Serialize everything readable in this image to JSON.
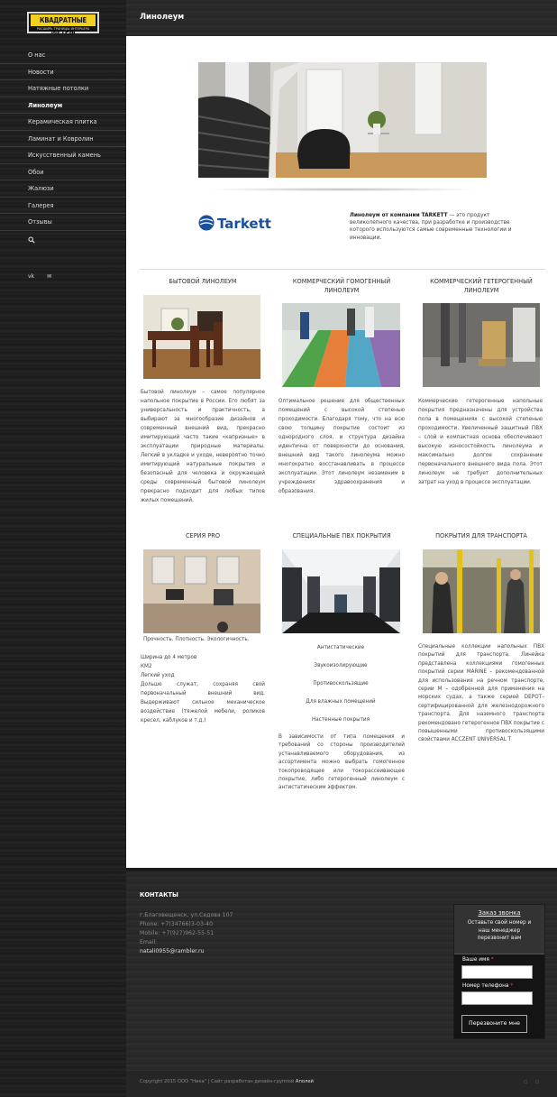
{
  "logo": {
    "line1": "КВАДРАТНЫЕ МЕТРЫ",
    "line2": "РАСШИРЬ ГРАНИЦЫ ИНТЕРЬЕРА"
  },
  "menu": [
    {
      "label": "О нас"
    },
    {
      "label": "Новости"
    },
    {
      "label": "Натяжные потолки"
    },
    {
      "label": "Линолеум",
      "active": true
    },
    {
      "label": "Керамическая плитка"
    },
    {
      "label": "Ламинат и Ковролин"
    },
    {
      "label": "Искусственный камень"
    },
    {
      "label": "Обои"
    },
    {
      "label": "Жалюзи"
    },
    {
      "label": "Галерея"
    },
    {
      "label": "Отзывы"
    }
  ],
  "social": {
    "vk": "vk",
    "mail": "✉"
  },
  "page_title": "Линолеум",
  "brand": "Tarkett",
  "intro": {
    "bold": "Линолеум от компании TARKETT",
    "rest": " — это продукт великолепного качества, при разработке и производстве которого используются самые современные технологии и инновации."
  },
  "columns": [
    {
      "title": "БЫТОВОЙ ЛИНОЛЕУМ",
      "text": "Бытовой линолеум – самое популярное напольное покрытие в России. Его любят за универсальность и практичность, а выбирают за многообразие дизайнов и современный внешний вид, прекрасно имитирующий часто такие «капризные» в эксплуатации природные материалы. Легкий в укладке и уходе, невероятно точно имитирующий натуральные покрытия и безопасный для человека и окружающей среды современный бытовой линолеум прекрасно подходит для любых типов жилых помещений."
    },
    {
      "title": "КОММЕРЧЕСКИЙ ГОМОГЕННЫЙ ЛИНОЛЕУМ",
      "text": "Оптимальное решение для общественных помещений с высокой степенью проходимости. Благодаря тому, что на всю свою толщину покрытие состоит из однородного слоя, и структура дизайна идентична от поверхности до основания, внешний вид такого линолеума можно многократно восстанавливать в процессе эксплуатации. Этот линолеум незаменим в учреждениях здравоохранения и образования."
    },
    {
      "title": "КОММЕРЧЕСКИЙ ГЕТЕРОГЕННЫЙ ЛИНОЛЕУМ",
      "text": "Коммерческие гетерогенные напольные покрытия предназначены для устройства пола в помещениях с высокой степенью проходимости. Увеличенный защитный ПВХ – слой и компактная основа обеспечивают высокую износостойкость линолеума и максимально долгое сохранение первоначального внешнего вида пола. Этот линолеум не требует дополнительных затрат на уход в процессе эксплуатации."
    }
  ],
  "series_pro": {
    "title": "СЕРИЯ PRO",
    "tagline": "Прочность. Плотность. Экологичность.",
    "lines": [
      "Ширина до 4 метров",
      "КМ2",
      "Легкий уход"
    ],
    "text": "Дольше служат, сохраняя свой первоначальный внешний вид. Выдерживают сильное механическое воздействие (тяжелой мебели, роликов кресел, каблуков и т.д.)"
  },
  "special": {
    "title": "СПЕЦИАЛЬНЫЕ ПВХ ПОКРЫТИЯ",
    "items": [
      "Антистатические",
      "Звукоизолирующие",
      "Противоскользящие",
      "Для влажных помещений",
      "Настенные покрытия"
    ],
    "text": "В зависимости от типа помещения и требований со стороны производителей устанавливаемого оборудования, из ассортимента можно выбрать гомогенное токопроводящее или токорассеивающее покрытие, либо гетерогенный линолеум с антистатическим эффектом."
  },
  "transport": {
    "title": "ПОКРЫТИЯ ДЛЯ ТРАНСПОРТА",
    "text": "Специальные коллекции напольных ПВХ покрытий для транспорта. Линейка представлена коллекциями гомогенных покрытий серии MARINE – рекомендованной для использования на речном транспорте, серии М – одобренной для применения на морских судах, а также серией DEPOT– сертифицированной для железнодорожного транспорта. Для наземного транспорта рекомендовано гетерогенное ПВХ покрытие с повышенными противоскользящими свойствами ACCZENT UNIVERSAL T"
  },
  "footer": {
    "title": "КОНТАКТЫ",
    "address": "г.Благовещенск, ул.Седова 107",
    "phone": "Phone: +7(34766)3-03-40",
    "mobile": "Mobile: +7(927)962-55-51",
    "email_label": "Email:",
    "email": "natali0955@rambler.ru"
  },
  "callback": {
    "title": "Заказ звонка",
    "subtitle": "Оставьте свой номер и наш менеджер перезвонит вам",
    "name_label": "Ваше имя",
    "phone_label": "Номер телефона",
    "required_mark": "*",
    "button": "Перезвоните мне"
  },
  "copyright": {
    "text": "Copyright 2015 ООО \"Ника\" | Сайт разработан дизайн-группой",
    "studio": "Аполей"
  },
  "colors": {
    "logo_yellow": "#f0d020",
    "brand_blue": "#1a4f9e",
    "accent_red": "#e44444"
  }
}
